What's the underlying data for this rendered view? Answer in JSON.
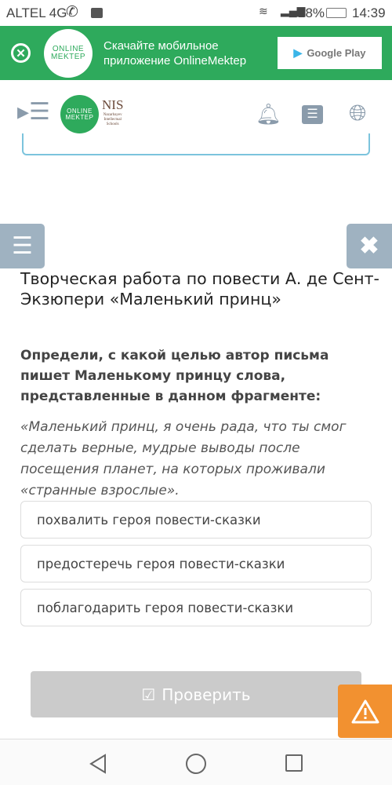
{
  "status_bar": {
    "carrier": "ALTEL 4G",
    "battery": "28%",
    "time": "14:39"
  },
  "banner": {
    "logo_text": [
      "ONLINE",
      "MEKTEP"
    ],
    "text_line1": "Скачайте мобильное",
    "text_line2": "приложение OnlineMektep",
    "store_button": "Google Play",
    "accent": "#2eaa5c"
  },
  "header": {
    "logo_text": [
      "ONLINE",
      "MEKTEP"
    ],
    "nis_logo": "NIS",
    "nis_sub": [
      "Nazarbayev",
      "Intellectual",
      "Schools"
    ]
  },
  "content": {
    "title": "Творческая работа по повести А. де Сент-Экзюпери «Маленький принц»",
    "question": "Определи, с какой целью автор письма пишет Маленькому принцу слова, представленные в данном фрагменте:",
    "quote": "«Маленький принц, я очень рада, что ты смог сделать верные, мудрые выводы после посещения планет, на которых проживали «странные взрослые».",
    "options": [
      "похвалить героя повести-сказки",
      "предостеречь героя повести-сказки",
      "поблагодарить героя повести-сказки"
    ],
    "check_button": "Проверить"
  },
  "colors": {
    "side_button": "#9fb2c1",
    "warning": "#f29130",
    "check_disabled": "#cbcbcb"
  }
}
